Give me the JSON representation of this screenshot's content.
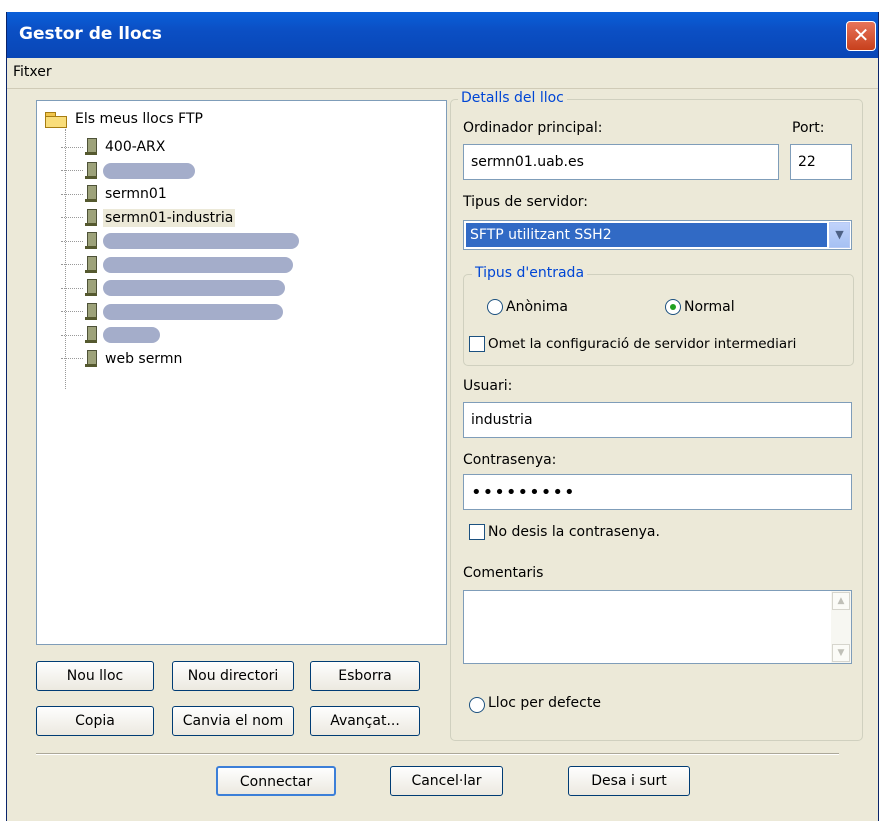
{
  "window": {
    "title": "Gestor de llocs",
    "close_label": "✕"
  },
  "menu": {
    "items": [
      "Fitxer"
    ]
  },
  "tree": {
    "root_label": "Els meus llocs FTP",
    "items": [
      {
        "label": "400-ARX",
        "redacted": false
      },
      {
        "label": "",
        "redacted": true
      },
      {
        "label": "sermn01",
        "redacted": false
      },
      {
        "label": "sermn01-industria",
        "redacted": false,
        "selected": true
      },
      {
        "label": "",
        "redacted": true
      },
      {
        "label": "",
        "redacted": true
      },
      {
        "label": "",
        "redacted": true
      },
      {
        "label": "",
        "redacted": true
      },
      {
        "label": "",
        "redacted": true
      },
      {
        "label": "web sermn",
        "redacted": false
      }
    ]
  },
  "tree_buttons": {
    "new_site": "Nou lloc",
    "new_folder": "Nou directori",
    "delete": "Esborra",
    "copy": "Copia",
    "rename": "Canvia el nom",
    "advanced": "Avançat..."
  },
  "details": {
    "legend": "Detalls del lloc",
    "host_label": "Ordinador principal:",
    "host_value": "sermn01.uab.es",
    "port_label": "Port:",
    "port_value": "22",
    "server_type_label": "Tipus de servidor:",
    "server_type_value": "SFTP utilitzant SSH2",
    "logon": {
      "legend": "Tipus d'entrada",
      "anonymous": "Anònima",
      "normal": "Normal",
      "selected": "normal",
      "bypass_proxy": "Omet la configuració de servidor intermediari"
    },
    "user_label": "Usuari:",
    "user_value": "industria",
    "password_label": "Contrasenya:",
    "password_value": "•••••••••",
    "dont_save_password": "No desis la contrasenya.",
    "comments_label": "Comentaris",
    "default_site": "Lloc per defecte"
  },
  "footer": {
    "connect": "Connectar",
    "cancel": "Cancel·lar",
    "save_exit": "Desa i surt"
  }
}
